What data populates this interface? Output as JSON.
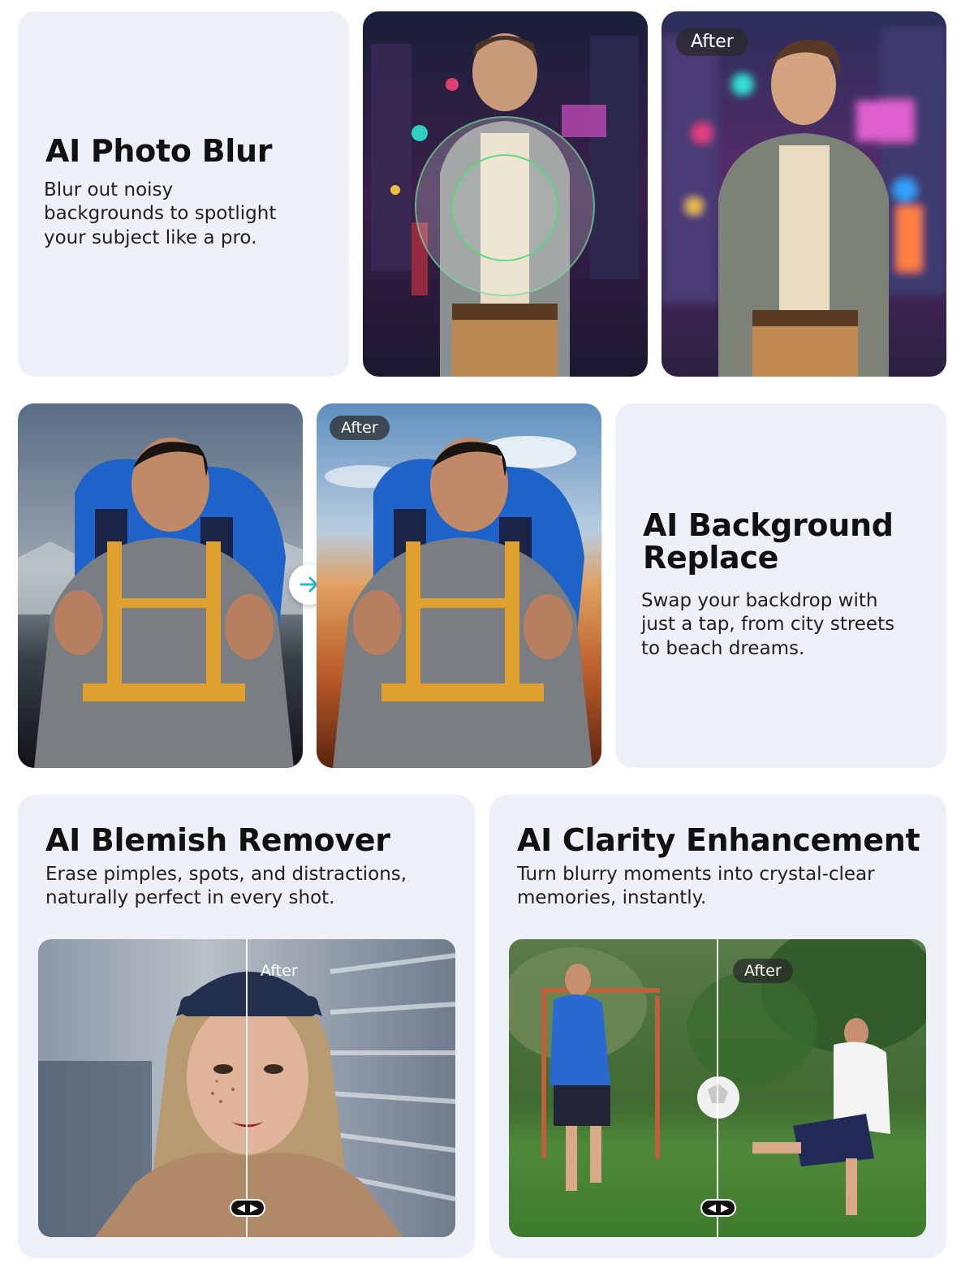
{
  "photo_blur": {
    "title": "AI Photo Blur",
    "description": "Blur out noisy backgrounds to spotlight your subject like a pro.",
    "after_badge": "After"
  },
  "background_replace": {
    "title": "AI Background Replace",
    "description": "Swap your backdrop with just a tap, from city streets to beach dreams.",
    "after_badge": "After",
    "arrow_icon": "arrow-right-icon"
  },
  "blemish_remover": {
    "title": "AI Blemish Remover",
    "description": "Erase pimples, spots, and distractions, naturally perfect in every shot.",
    "after_badge": "After",
    "slider_icon": "compare-slider-icon"
  },
  "clarity_enhancement": {
    "title": "AI Clarity Enhancement",
    "description": "Turn blurry moments into crystal-clear memories, instantly.",
    "after_badge": "After",
    "slider_icon": "compare-slider-icon"
  },
  "colors": {
    "card_bg": "#edf1f7",
    "accent_arrow": "#2bb3c9"
  }
}
